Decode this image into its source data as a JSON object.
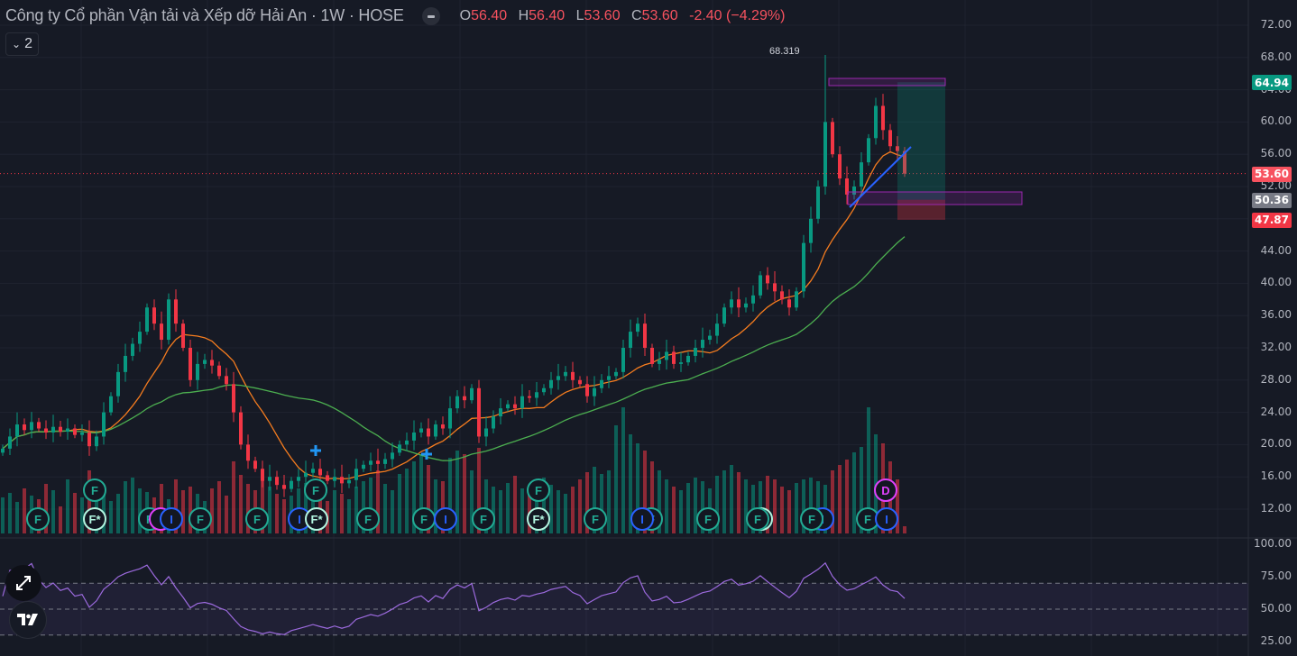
{
  "header": {
    "title": "Công ty Cổ phần Vận tải và Xếp dỡ Hải An · 1W · HOSE",
    "ohlc": [
      {
        "key": "O",
        "value": "56.40"
      },
      {
        "key": "H",
        "value": "56.40"
      },
      {
        "key": "L",
        "value": "53.60"
      },
      {
        "key": "C",
        "value": "53.60"
      }
    ],
    "change": "-2.40 (−4.29%)",
    "indicators_collapsed_count": "2"
  },
  "price_axis": [
    "72.00",
    "68.00",
    "64.00",
    "60.00",
    "56.00",
    "52.00",
    "48.00",
    "44.00",
    "40.00",
    "36.00",
    "32.00",
    "28.00",
    "24.00",
    "20.00",
    "16.00",
    "12.00"
  ],
  "rsi_axis": [
    "100.00",
    "75.00",
    "50.00",
    "25.00"
  ],
  "price_tags": [
    {
      "label": "64.94",
      "value": 64.94,
      "color": "#089981"
    },
    {
      "label": "53.60",
      "value": 53.6,
      "color": "#f7525f"
    },
    {
      "label": "50.36",
      "value": 50.36,
      "color": "#787b86"
    },
    {
      "label": "47.87",
      "value": 47.87,
      "color": "#f23645"
    }
  ],
  "high_marker": {
    "label": "68.319",
    "index": 114,
    "value": 68.319
  },
  "colors": {
    "up": "#089981",
    "down": "#f23645",
    "ma_fast": "#f57c1f",
    "ma_slow": "#4caf50",
    "rsi": "#9c6ade",
    "trendline": "#2962ff"
  },
  "chart_data": {
    "type": "candlestick",
    "closes": [
      19.5,
      21,
      22.5,
      21.8,
      22.8,
      22,
      21.5,
      22.2,
      21.6,
      22,
      21.2,
      21.5,
      19.8,
      21,
      24,
      26,
      29,
      31,
      32.5,
      34,
      37,
      35,
      33,
      38,
      35,
      32,
      28,
      30,
      30.5,
      29.8,
      28.5,
      27.5,
      24,
      20,
      18,
      17,
      15.5,
      16,
      15,
      14.5,
      15.5,
      16,
      16.5,
      17,
      16.2,
      15.5,
      16,
      15.2,
      15.6,
      17,
      17.5,
      18,
      17.6,
      18.2,
      19,
      20,
      20.5,
      21.5,
      22,
      21,
      22.5,
      22,
      24.5,
      26,
      25.5,
      27,
      21,
      22,
      23.5,
      24.5,
      25,
      24.5,
      26,
      25.8,
      26.5,
      27,
      28,
      28.5,
      29,
      28,
      27.5,
      26,
      27,
      28,
      28.5,
      29,
      32,
      34,
      35,
      32,
      30,
      30.5,
      31.5,
      30,
      30.2,
      31,
      32,
      33,
      33.5,
      35,
      37,
      38,
      37,
      37.5,
      38.5,
      41,
      40,
      39,
      38,
      37,
      39,
      45,
      48,
      52,
      60,
      56,
      53,
      51,
      52,
      55,
      58,
      62,
      59,
      57,
      56.4,
      53.6
    ],
    "volumes": [
      40,
      45,
      35,
      50,
      42,
      38,
      55,
      48,
      30,
      60,
      45,
      40,
      70,
      52,
      48,
      36,
      44,
      58,
      62,
      50,
      46,
      40,
      55,
      38,
      60,
      48,
      52,
      44,
      36,
      50,
      58,
      42,
      80,
      65,
      55,
      48,
      60,
      52,
      44,
      38,
      42,
      50,
      56,
      46,
      40,
      36,
      48,
      44,
      38,
      52,
      58,
      62,
      70,
      55,
      48,
      66,
      72,
      80,
      88,
      76,
      60,
      58,
      84,
      92,
      88,
      70,
      95,
      60,
      52,
      48,
      56,
      64,
      50,
      46,
      58,
      62,
      54,
      48,
      44,
      52,
      60,
      68,
      74,
      66,
      70,
      120,
      140,
      110,
      100,
      92,
      80,
      70,
      60,
      52,
      48,
      56,
      62,
      58,
      50,
      64,
      70,
      76,
      68,
      60,
      54,
      58,
      64,
      60,
      52,
      48,
      56,
      60,
      62,
      58,
      54,
      70,
      76,
      82,
      90,
      96,
      140,
      110,
      100,
      80,
      60,
      8
    ],
    "ma_fast_period": 10,
    "ma_slow_period": 30,
    "rsi_period": 14,
    "ylim": [
      12,
      72
    ],
    "rsi_levels": [
      70,
      50,
      30
    ]
  },
  "events": [
    {
      "label": "F",
      "kind": "F",
      "x": 42,
      "row": 0
    },
    {
      "label": "F",
      "kind": "F",
      "x": 105,
      "row": 1
    },
    {
      "label": "F*",
      "kind": "Fs",
      "x": 105,
      "row": 0
    },
    {
      "label": "F",
      "kind": "F",
      "x": 166,
      "row": 0
    },
    {
      "label": "",
      "kind": "D",
      "x": 178,
      "row": 0
    },
    {
      "label": "I",
      "kind": "I",
      "x": 190,
      "row": 0
    },
    {
      "label": "F",
      "kind": "F",
      "x": 222,
      "row": 0
    },
    {
      "label": "F",
      "kind": "F",
      "x": 285,
      "row": 0
    },
    {
      "label": "I",
      "kind": "I",
      "x": 332,
      "row": 0
    },
    {
      "label": "F",
      "kind": "F",
      "x": 350,
      "row": 1
    },
    {
      "label": "F*",
      "kind": "Fs",
      "x": 351,
      "row": 0
    },
    {
      "label": "F",
      "kind": "F",
      "x": 408,
      "row": 0
    },
    {
      "label": "F",
      "kind": "F",
      "x": 470,
      "row": 0
    },
    {
      "label": "I",
      "kind": "I",
      "x": 494,
      "row": 0
    },
    {
      "label": "F",
      "kind": "F",
      "x": 536,
      "row": 0
    },
    {
      "label": "F",
      "kind": "F",
      "x": 597,
      "row": 1
    },
    {
      "label": "F*",
      "kind": "Fs",
      "x": 597,
      "row": 0
    },
    {
      "label": "F",
      "kind": "F",
      "x": 660,
      "row": 0
    },
    {
      "label": "F",
      "kind": "F",
      "x": 722,
      "row": 0
    },
    {
      "label": "I",
      "kind": "I",
      "x": 712,
      "row": 0
    },
    {
      "label": "F",
      "kind": "F",
      "x": 785,
      "row": 0
    },
    {
      "label": "F",
      "kind": "Fs",
      "x": 844,
      "row": 0
    },
    {
      "label": "F",
      "kind": "F",
      "x": 840,
      "row": 0
    },
    {
      "label": "I",
      "kind": "I",
      "x": 912,
      "row": 0
    },
    {
      "label": "F",
      "kind": "F",
      "x": 900,
      "row": 0
    },
    {
      "label": "F",
      "kind": "F",
      "x": 962,
      "row": 0
    },
    {
      "label": "I",
      "kind": "I",
      "x": 983,
      "row": 0
    },
    {
      "label": "D",
      "kind": "D",
      "x": 982,
      "row": 1
    }
  ],
  "buttons": {
    "fullscreen": "fullscreen-icon",
    "logo": "tradingview-logo"
  }
}
